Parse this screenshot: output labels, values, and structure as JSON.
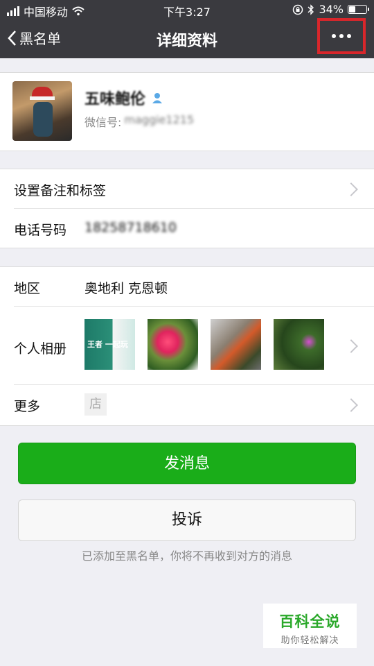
{
  "status_bar": {
    "carrier": "中国移动",
    "time": "下午3:27",
    "battery_percent_text": "34%",
    "battery_level": 0.34
  },
  "nav": {
    "back_label": "黑名单",
    "title": "详细资料"
  },
  "profile": {
    "name": "五味鲍伦",
    "wechat_id_label": "微信号:",
    "wechat_id_value": "maggie1215"
  },
  "details": {
    "remark_label": "设置备注和标签",
    "phone_label": "电话号码",
    "phone_value": "18258718610"
  },
  "info": {
    "region_label": "地区",
    "region_value": "奥地利 克恩顿",
    "album_label": "个人相册",
    "album_thumb1_text": "王者 一起玩",
    "more_label": "更多",
    "shop_icon_text": "店"
  },
  "actions": {
    "send_message": "发消息",
    "complain": "投诉",
    "blacklist_hint": "已添加至黑名单，你将不再收到对方的消息"
  },
  "watermark": {
    "title": "百科全说",
    "subtitle": "助你轻松解决"
  },
  "colors": {
    "nav_bg": "#3a3a3f",
    "primary_green": "#1aad19",
    "highlight_red": "#d9262b"
  }
}
